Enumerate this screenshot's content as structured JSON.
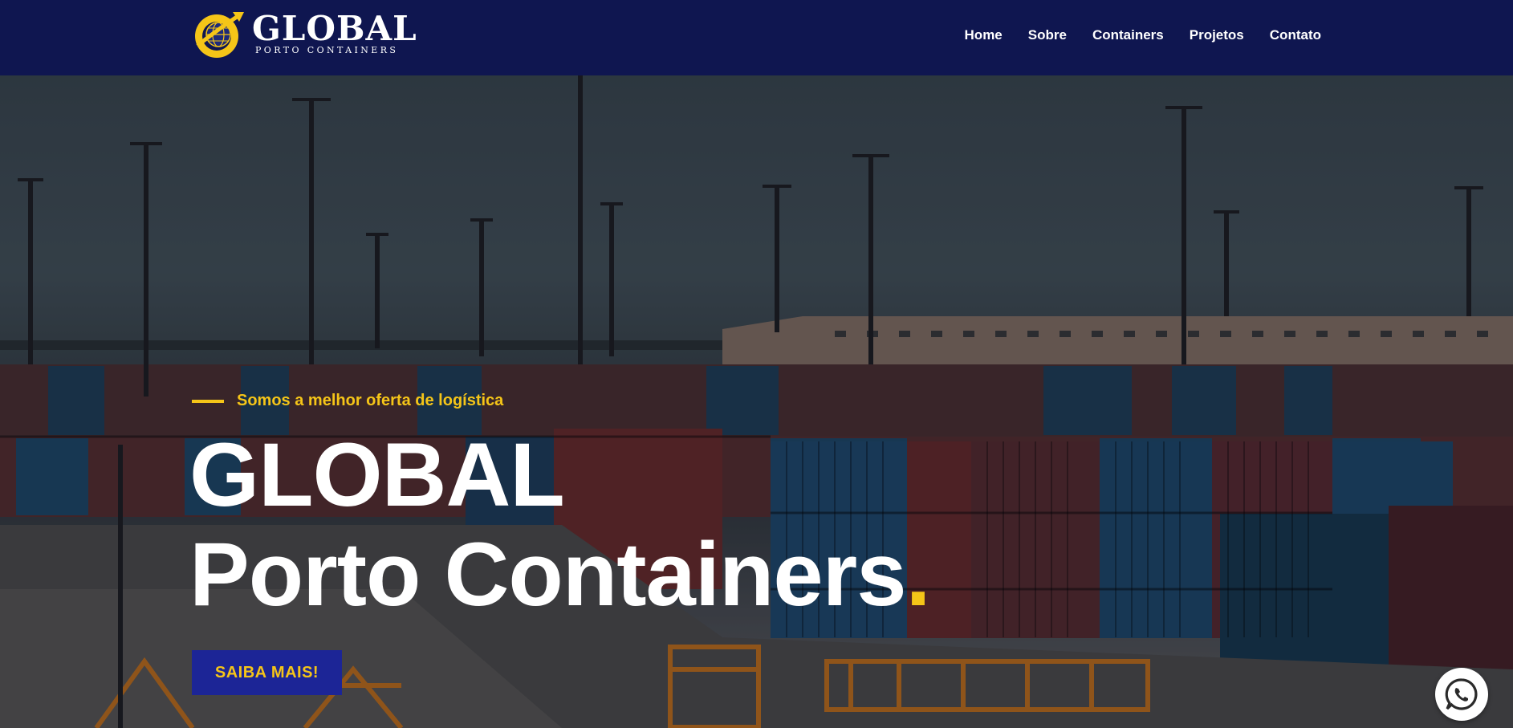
{
  "header": {
    "logo": {
      "word": "GLOBAL",
      "sub": "PORTO CONTAINERS"
    },
    "nav": [
      {
        "label": "Home"
      },
      {
        "label": "Sobre"
      },
      {
        "label": "Containers"
      },
      {
        "label": "Projetos"
      },
      {
        "label": "Contato"
      }
    ]
  },
  "hero": {
    "tagline": "Somos a melhor oferta de logística",
    "title_line1": "GLOBAL",
    "title_line2": "Porto Containers",
    "title_dot": ".",
    "cta_label": "SAIBA MAIS!"
  },
  "floating": {
    "whatsapp_icon": "whatsapp-icon"
  },
  "colors": {
    "header_bg": "#0f1650",
    "accent": "#f5c518",
    "cta_bg": "#1c2596",
    "text": "#ffffff"
  }
}
